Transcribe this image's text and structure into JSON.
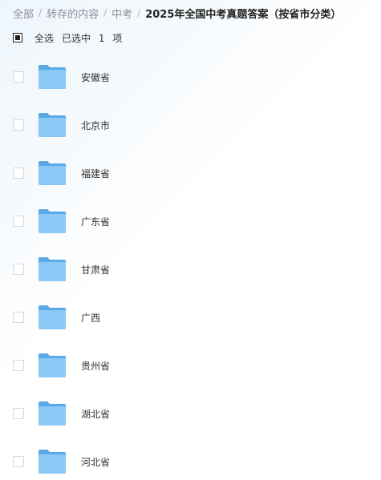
{
  "breadcrumb": {
    "items": [
      "全部",
      "转存的内容",
      "中考"
    ],
    "separator": "/",
    "current": "2025年全国中考真题答案（按省市分类）"
  },
  "selection": {
    "select_all_label": "全选",
    "selected_prefix": "已选中",
    "selected_count": "1",
    "selected_unit": "项"
  },
  "files": [
    {
      "name": "安徽省",
      "icon": "folder-icon"
    },
    {
      "name": "北京市",
      "icon": "folder-icon"
    },
    {
      "name": "福建省",
      "icon": "folder-icon"
    },
    {
      "name": "广东省",
      "icon": "folder-icon"
    },
    {
      "name": "甘肃省",
      "icon": "folder-icon"
    },
    {
      "name": "广西",
      "icon": "folder-icon"
    },
    {
      "name": "贵州省",
      "icon": "folder-icon"
    },
    {
      "name": "湖北省",
      "icon": "folder-icon"
    },
    {
      "name": "河北省",
      "icon": "folder-icon"
    }
  ],
  "colors": {
    "folder_back": "#5aa9e6",
    "folder_front": "#8cc8f5",
    "text": "#333333",
    "crumb": "#8a8f99"
  }
}
